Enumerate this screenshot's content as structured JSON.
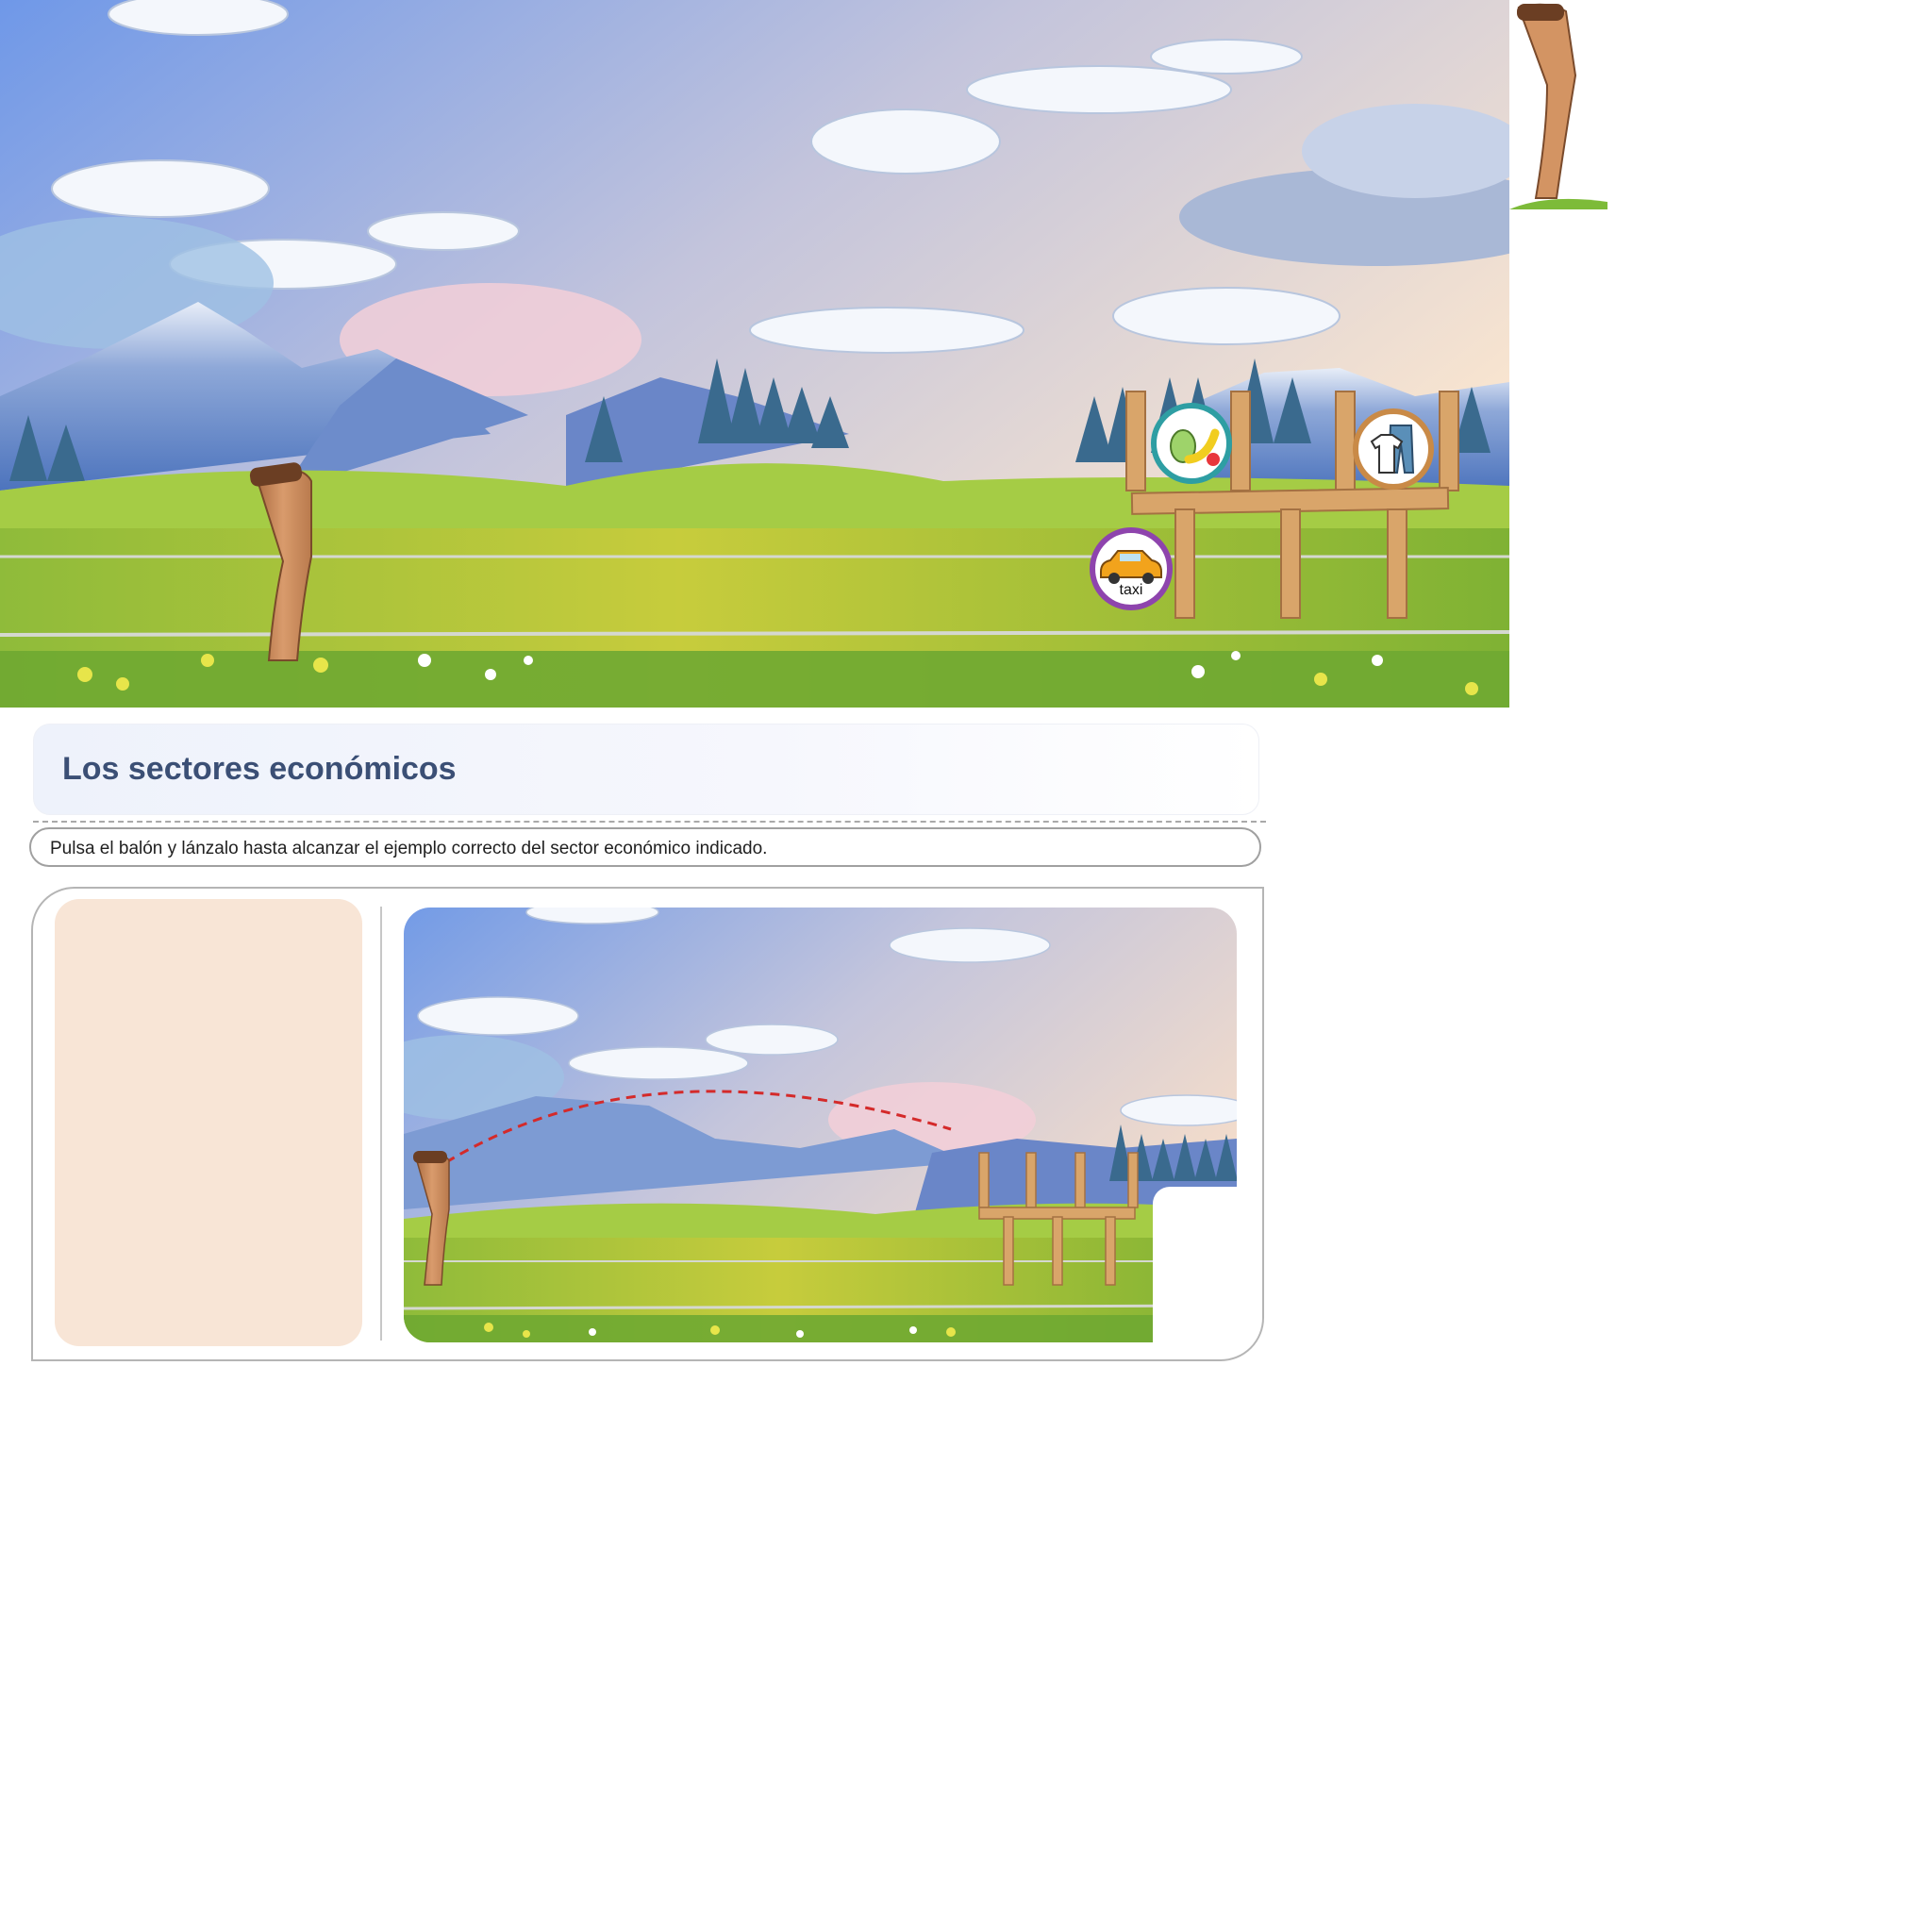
{
  "page": {
    "title": "Los sectores económicos",
    "instruction": "Pulsa el balón y lánzalo hasta alcanzar el ejemplo correcto del sector económico indicado."
  },
  "hero": {
    "targets": [
      {
        "icon": "fruit-icon",
        "label": ""
      },
      {
        "icon": "clothes-icon",
        "label": ""
      },
      {
        "icon": "taxi-icon",
        "label": "taxi"
      }
    ]
  },
  "game": {
    "prompt": "",
    "trajectory_shown": true
  },
  "colors": {
    "title": "#3b4f75",
    "prompt_panel": "#f8e5d6",
    "fruit_ring": "#2e9ea3",
    "clothes_ring": "#c98a47",
    "taxi_ring": "#8e44ad",
    "trajectory": "#d42a2a"
  }
}
